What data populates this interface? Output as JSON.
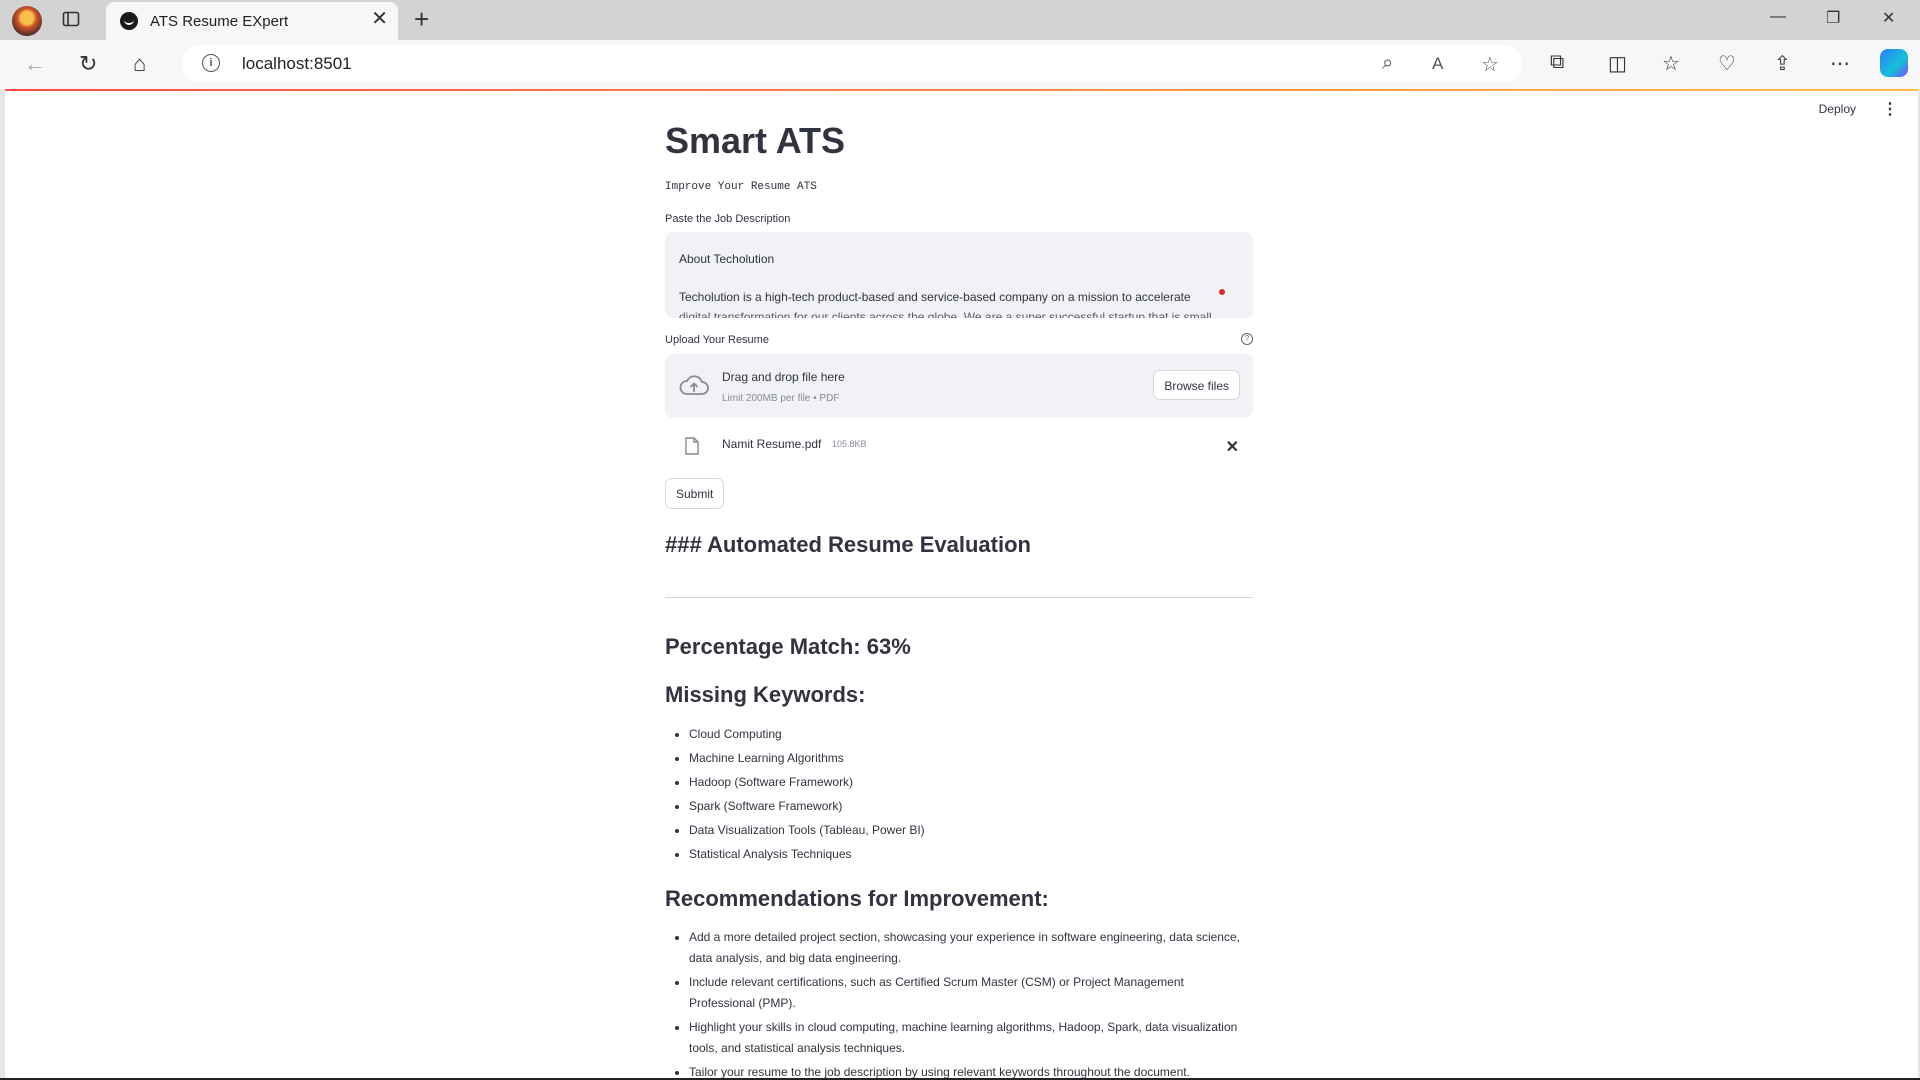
{
  "browser": {
    "tab_title": "ATS Resume EXpert",
    "url": "localhost:8501"
  },
  "toolbar": {
    "deploy_label": "Deploy"
  },
  "app": {
    "title": "Smart ATS",
    "subtitle": "Improve Your Resume ATS",
    "job_description": {
      "label": "Paste the Job Description",
      "line1": "About Techolution",
      "line2": "Techolution is a high-tech product-based and service-based company on a mission to accelerate"
    },
    "upload": {
      "label": "Upload Your Resume",
      "drag_text": "Drag and drop file here",
      "limit_text": "Limit 200MB per file • PDF",
      "browse_label": "Browse files",
      "file_name": "Namit Resume.pdf",
      "file_size": "105.8KB"
    },
    "submit_label": "Submit"
  },
  "results": {
    "heading": "### Automated Resume Evaluation",
    "percentage_match": "Percentage Match: 63%",
    "missing_heading": "Missing Keywords:",
    "missing_keywords": [
      "Cloud Computing",
      "Machine Learning Algorithms",
      "Hadoop (Software Framework)",
      "Spark (Software Framework)",
      "Data Visualization Tools (Tableau, Power BI)",
      "Statistical Analysis Techniques"
    ],
    "recommendations_heading": "Recommendations for Improvement:",
    "recommendations": [
      "Add a more detailed project section, showcasing your experience in software engineering, data science, data analysis, and big data engineering.",
      "Include relevant certifications, such as Certified Scrum Master (CSM) or Project Management Professional (PMP).",
      "Highlight your skills in cloud computing, machine learning algorithms, Hadoop, Spark, data visualization tools, and statistical analysis techniques.",
      "Tailor your resume to the job description by using relevant keywords throughout the document."
    ]
  },
  "icons": {
    "profile": "profile-avatar",
    "tab_favicon": "streamlit-crown-icon",
    "upload": "cloud-upload-icon",
    "file": "file-icon"
  },
  "colors": {
    "accent_gradient_start": "#ff4b4b",
    "accent_gradient_end": "#ffbd45",
    "input_bg": "#f0f2f6",
    "text": "#31333f"
  }
}
